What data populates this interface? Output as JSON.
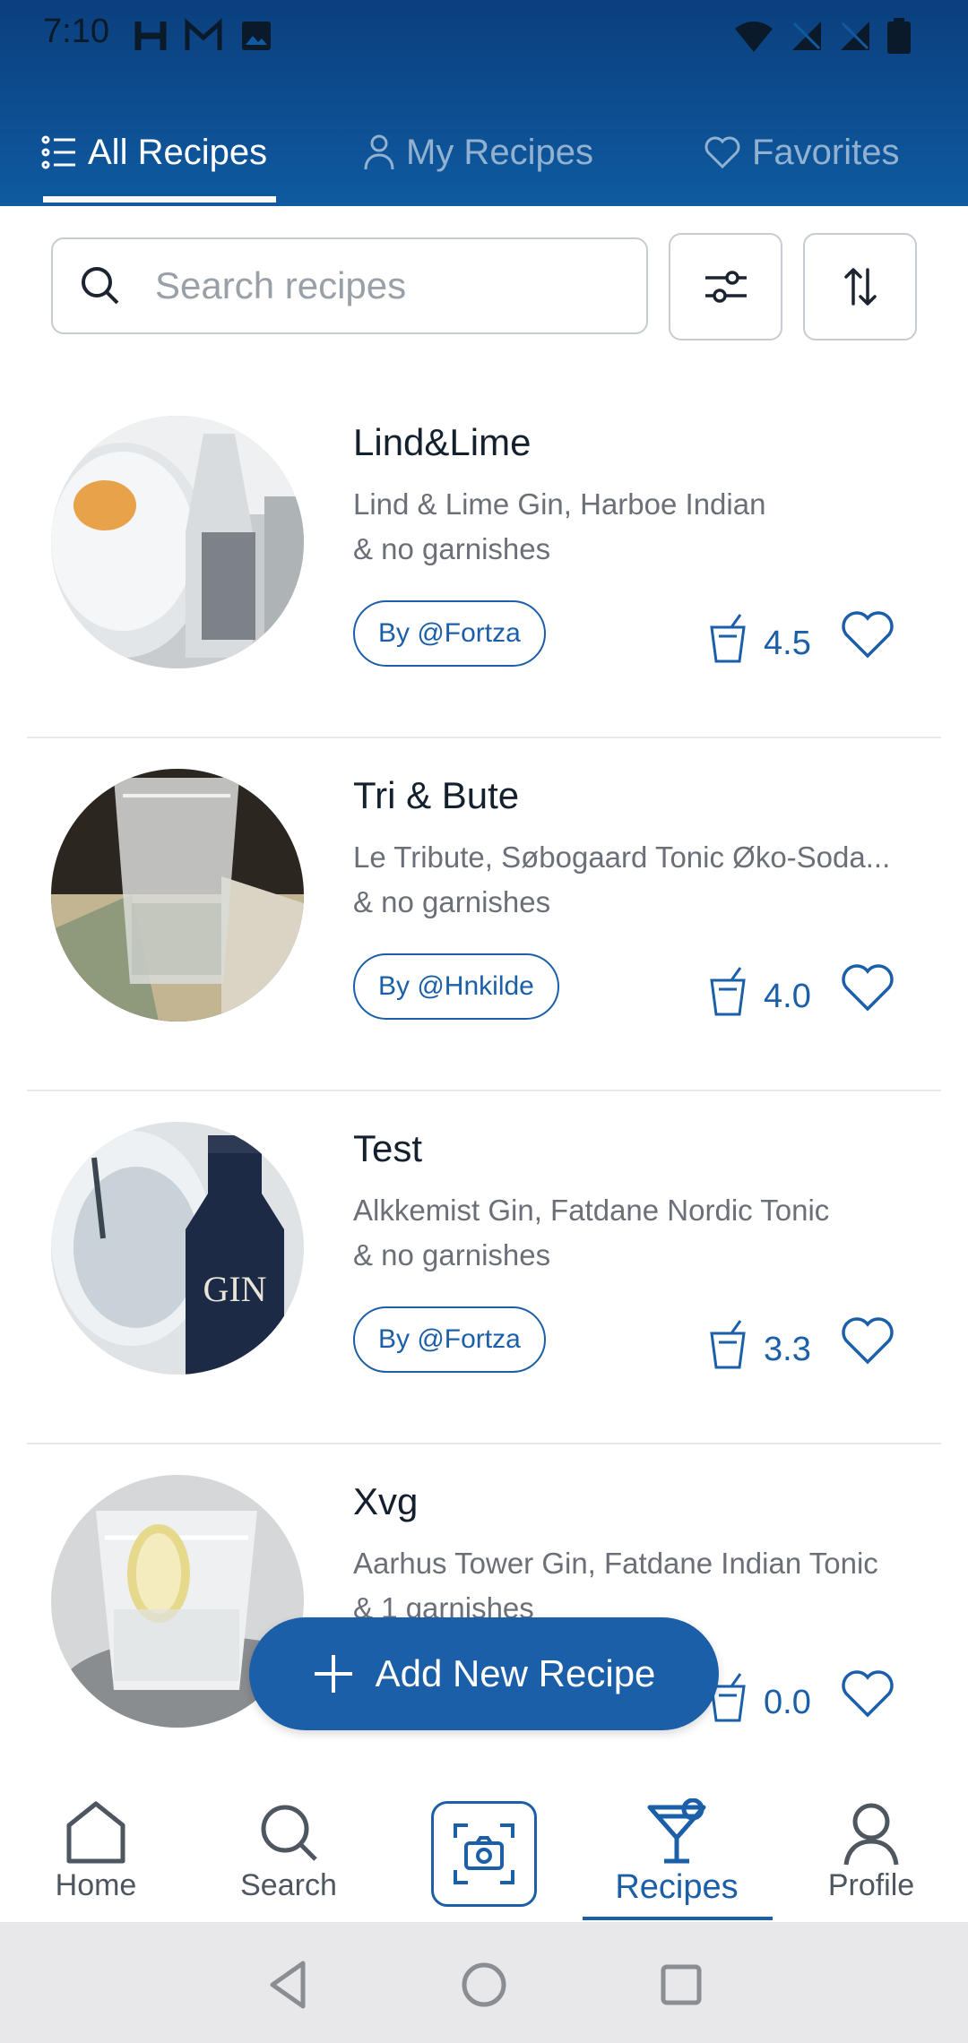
{
  "status_bar": {
    "time": "7:10"
  },
  "tabs": [
    {
      "label": "All Recipes",
      "icon": "list-icon",
      "active": true
    },
    {
      "label": "My Recipes",
      "icon": "person-icon",
      "active": false
    },
    {
      "label": "Favorites",
      "icon": "heart-icon",
      "active": false
    }
  ],
  "search": {
    "placeholder": "Search recipes",
    "value": ""
  },
  "recipes": [
    {
      "title": "Lind&Lime",
      "desc_line1": "Lind & Lime Gin, Harboe Indian",
      "desc_line2": "& no garnishes",
      "author": "By @Fortza",
      "rating": "4.5"
    },
    {
      "title": "Tri & Bute",
      "desc_line1": "Le Tribute, Søbogaard Tonic Øko-Soda...",
      "desc_line2": "& no garnishes",
      "author": "By @Hnkilde",
      "rating": "4.0"
    },
    {
      "title": "Test",
      "desc_line1": "Alkkemist Gin, Fatdane Nordic Tonic",
      "desc_line2": "& no garnishes",
      "author": "By @Fortza",
      "rating": "3.3"
    },
    {
      "title": "Xvg",
      "desc_line1": "Aarhus Tower Gin, Fatdane Indian Tonic",
      "desc_line2": "& 1 garnishes",
      "author": "",
      "rating": "0.0"
    }
  ],
  "add_button": {
    "label": "Add New Recipe"
  },
  "bottom_nav": {
    "home": "Home",
    "search": "Search",
    "recipes": "Recipes",
    "profile": "Profile"
  },
  "colors": {
    "primary": "#1a5fa8",
    "header_top": "#0b3f7d",
    "header_bottom": "#0f5aa1"
  }
}
